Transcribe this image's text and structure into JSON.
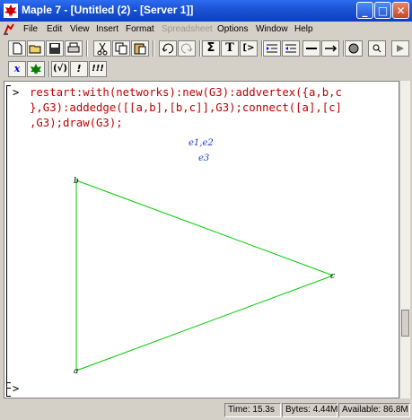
{
  "window": {
    "title": "Maple 7 - [Untitled (2) - [Server 1]]",
    "controls": [
      "minimize",
      "maximize",
      "close"
    ]
  },
  "menu": {
    "items": [
      {
        "label": "File",
        "enabled": true
      },
      {
        "label": "Edit",
        "enabled": true
      },
      {
        "label": "View",
        "enabled": true
      },
      {
        "label": "Insert",
        "enabled": true
      },
      {
        "label": "Format",
        "enabled": true
      },
      {
        "label": "Spreadsheet",
        "enabled": false
      },
      {
        "label": "Options",
        "enabled": true
      },
      {
        "label": "Window",
        "enabled": true
      },
      {
        "label": "Help",
        "enabled": true
      }
    ]
  },
  "toolbar": {
    "buttons": [
      "new-icon",
      "open-icon",
      "save-icon",
      "print-icon",
      "cut-icon",
      "copy-icon",
      "paste-icon",
      "undo-icon",
      "redo-icon",
      "sigma-icon",
      "text-icon",
      "prompt-icon",
      "indent-icon",
      "outdent-icon",
      "collapse-icon",
      "expand-icon",
      "stop-icon",
      "zoom-icon",
      "restart-icon"
    ],
    "sigma_label": "Σ",
    "text_label": "T",
    "prompt_label": "[>"
  },
  "context_toolbar": {
    "x_label": "x",
    "func_label": "(√)",
    "exec_label": "!",
    "execall_label": "!!!"
  },
  "worksheet": {
    "prompt": ">",
    "command_lines": [
      "restart:with(networks):new(G3):addvertex({a,b,c",
      "},G3):addedge([[a,b],[b,c]],G3);connect([a],[c]",
      ",G3);draw(G3);"
    ],
    "output_lines": [
      "e1,e2",
      "e3"
    ],
    "prompt2": ">"
  },
  "plot": {
    "vertex_labels": [
      "b",
      "c",
      "a"
    ],
    "edge_color": "#00cc00",
    "label_color": "#1e3ccf"
  },
  "status": {
    "time": "Time: 15.3s",
    "bytes": "Bytes: 4.44M",
    "available": "Available: 86.8M"
  },
  "colors": {
    "command": "#c00000",
    "title_bar": "#1c55d6",
    "plot_edges": "#00cc00"
  }
}
